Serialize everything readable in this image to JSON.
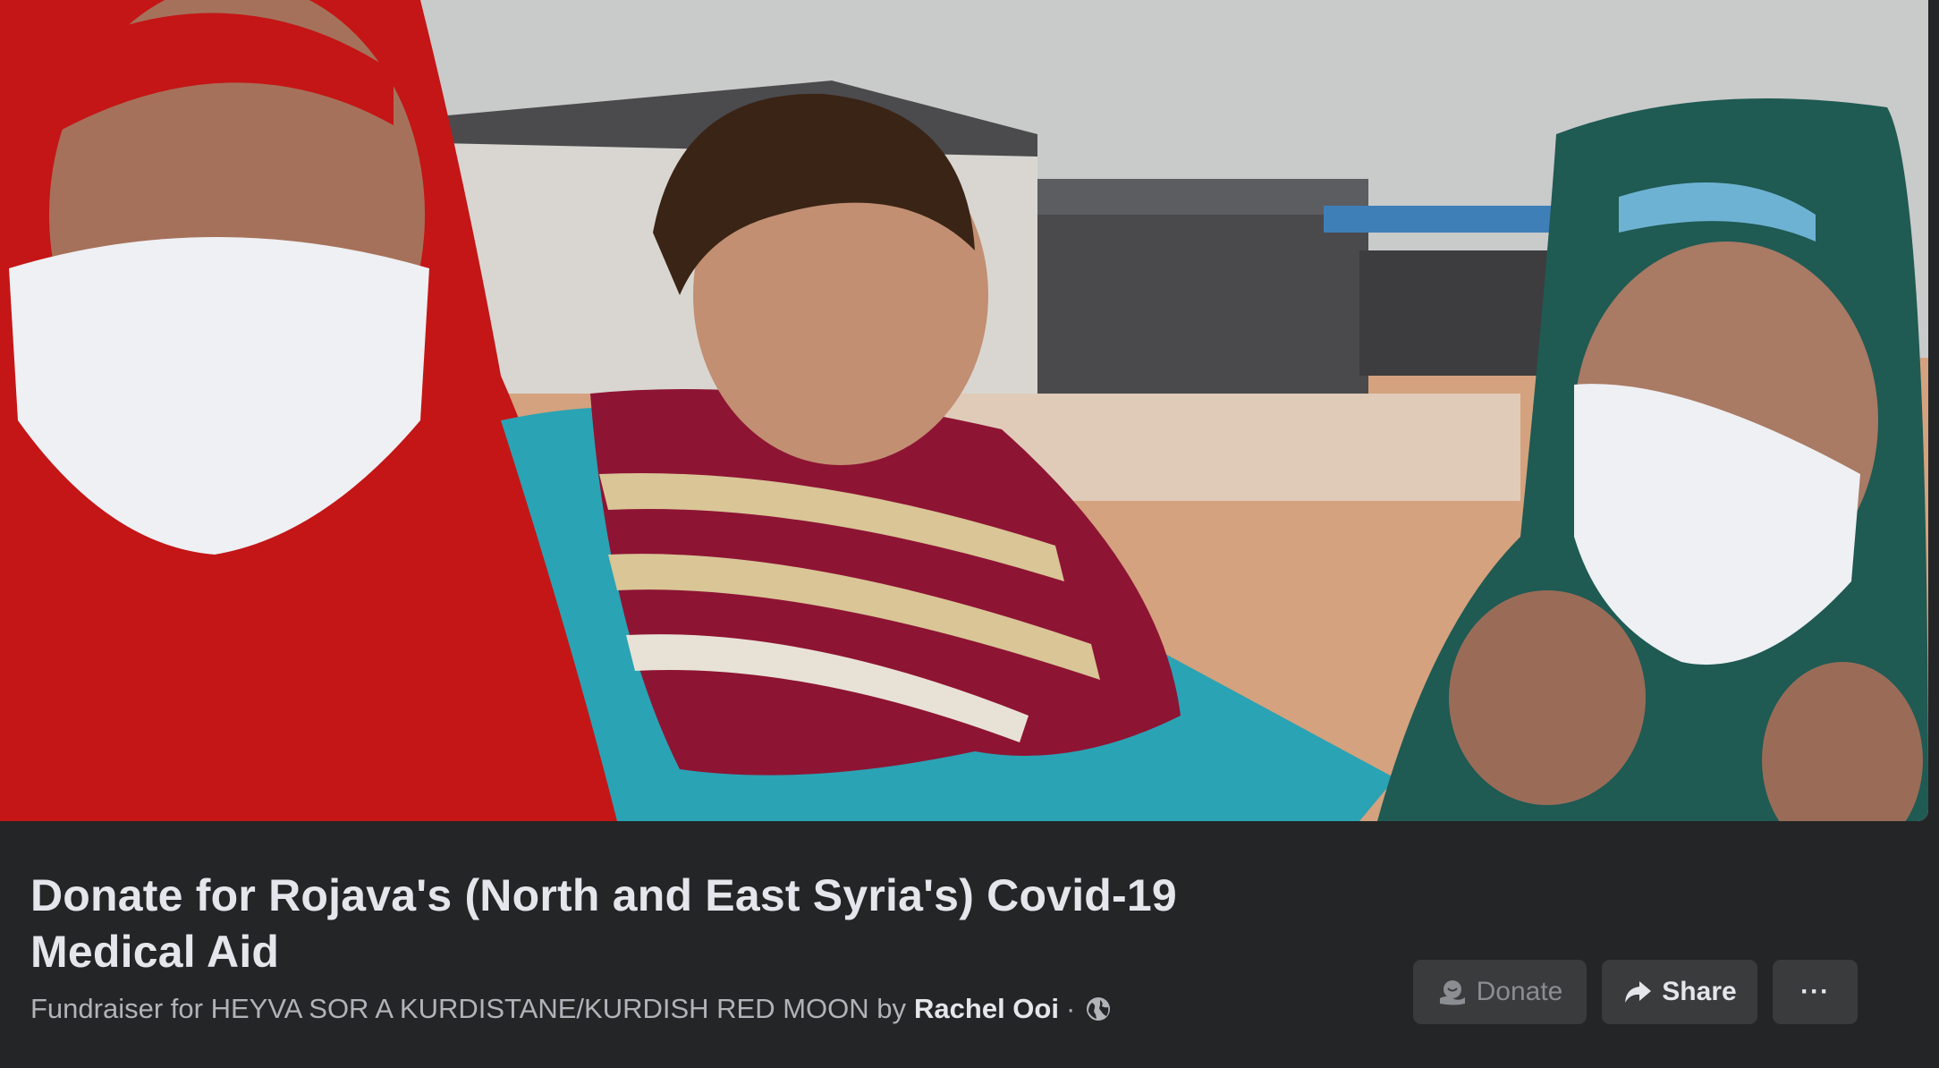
{
  "cover": {
    "image_description_icon": "cover-photo"
  },
  "fundraiser": {
    "title": "Donate for Rojava's (North and East Syria's) Covid-19 Medical Aid",
    "subtitle_prefix": "Fundraiser for HEYVA SOR A KURDISTANE/KURDISH RED MOON by",
    "author": "Rachel Ooi",
    "separator": "·",
    "privacy_icon": "globe-icon"
  },
  "actions": {
    "donate_label": "Donate",
    "donate_icon": "donation-icon",
    "share_label": "Share",
    "share_icon": "share-arrow-icon",
    "more_label": "···"
  },
  "colors": {
    "background": "#242526",
    "title_text": "#e4e6eb",
    "secondary_text": "#b0b3b8",
    "button_bg": "#3a3b3c",
    "disabled_text": "#8a8d91"
  }
}
